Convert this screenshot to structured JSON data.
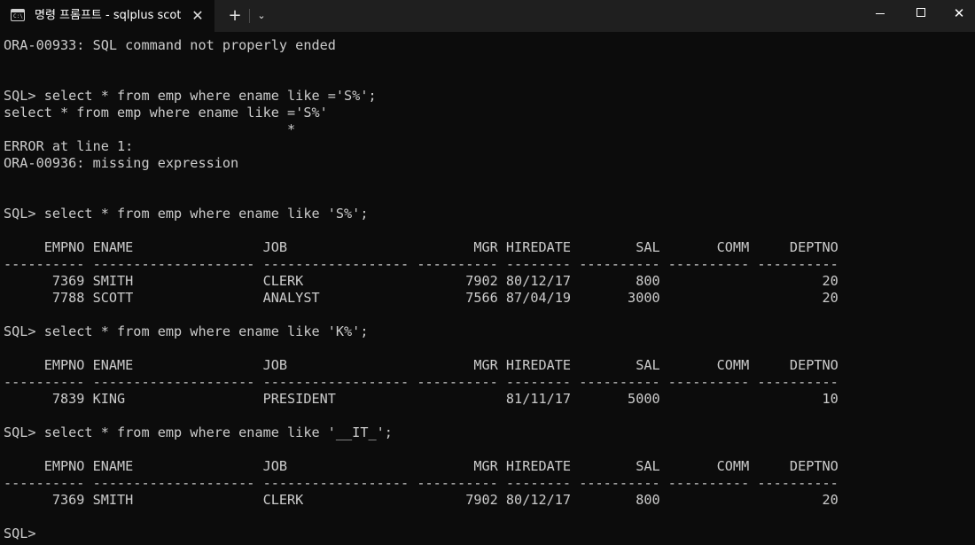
{
  "window": {
    "tab_title": "명령 프롬프트 - sqlplus  scott/",
    "tab_icon_glyph": "C:\\",
    "close_tab_symbol": "✕",
    "new_tab_symbol": "+",
    "dropdown_symbol": "⌄",
    "close_window_symbol": "✕"
  },
  "terminal": {
    "lines": [
      "ORA-00933: SQL command not properly ended",
      "",
      "",
      "SQL> select * from emp where ename like ='S%';",
      "select * from emp where ename like ='S%'",
      "                                   *",
      "ERROR at line 1:",
      "ORA-00936: missing expression",
      "",
      "",
      "SQL> select * from emp where ename like 'S%';",
      "",
      "     EMPNO ENAME                JOB                       MGR HIREDATE        SAL       COMM     DEPTNO",
      "---------- -------------------- ------------------ ---------- -------- ---------- ---------- ----------",
      "      7369 SMITH                CLERK                    7902 80/12/17        800                    20",
      "      7788 SCOTT                ANALYST                  7566 87/04/19       3000                    20",
      "",
      "SQL> select * from emp where ename like 'K%';",
      "",
      "     EMPNO ENAME                JOB                       MGR HIREDATE        SAL       COMM     DEPTNO",
      "---------- -------------------- ------------------ ---------- -------- ---------- ---------- ----------",
      "      7839 KING                 PRESIDENT                     81/11/17       5000                    10",
      "",
      "SQL> select * from emp where ename like '__IT_';",
      "",
      "     EMPNO ENAME                JOB                       MGR HIREDATE        SAL       COMM     DEPTNO",
      "---------- -------------------- ------------------ ---------- -------- ---------- ---------- ----------",
      "      7369 SMITH                CLERK                    7902 80/12/17        800                    20",
      "",
      "SQL>"
    ]
  },
  "colors": {
    "background": "#0c0c0c",
    "titlebar": "#1f1f1f",
    "text": "#cccccc"
  }
}
